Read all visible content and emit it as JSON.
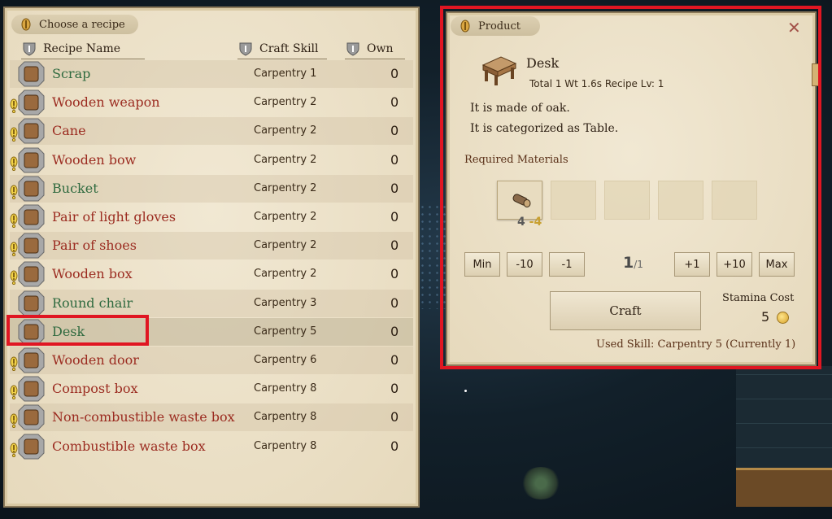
{
  "recipe_panel": {
    "tab_title": "Choose a recipe",
    "columns": {
      "name": "Recipe Name",
      "skill": "Craft Skill",
      "own": "Own"
    },
    "rows": [
      {
        "name": "Scrap",
        "skill": "Carpentry 1",
        "own": "0",
        "color": "green",
        "icon": "scrap-icon",
        "warn": false
      },
      {
        "name": "Wooden weapon",
        "skill": "Carpentry 2",
        "own": "0",
        "color": "red",
        "icon": "wooden-weapon-icon",
        "warn": true
      },
      {
        "name": "Cane",
        "skill": "Carpentry 2",
        "own": "0",
        "color": "red",
        "icon": "cane-icon",
        "warn": true
      },
      {
        "name": "Wooden bow",
        "skill": "Carpentry 2",
        "own": "0",
        "color": "red",
        "icon": "wooden-bow-icon",
        "warn": true
      },
      {
        "name": "Bucket",
        "skill": "Carpentry 2",
        "own": "0",
        "color": "green",
        "icon": "bucket-icon",
        "warn": true
      },
      {
        "name": "Pair of light gloves",
        "skill": "Carpentry 2",
        "own": "0",
        "color": "red",
        "icon": "gloves-icon",
        "warn": true
      },
      {
        "name": "Pair of shoes",
        "skill": "Carpentry 2",
        "own": "0",
        "color": "red",
        "icon": "shoes-icon",
        "warn": true
      },
      {
        "name": "Wooden box",
        "skill": "Carpentry 2",
        "own": "0",
        "color": "red",
        "icon": "wooden-box-icon",
        "warn": true
      },
      {
        "name": "Round chair",
        "skill": "Carpentry 3",
        "own": "0",
        "color": "green",
        "icon": "round-chair-icon",
        "warn": false
      },
      {
        "name": "Desk",
        "skill": "Carpentry 5",
        "own": "0",
        "color": "green",
        "icon": "desk-icon",
        "warn": false
      },
      {
        "name": "Wooden door",
        "skill": "Carpentry 6",
        "own": "0",
        "color": "red",
        "icon": "wooden-door-icon",
        "warn": true
      },
      {
        "name": "Compost box",
        "skill": "Carpentry 8",
        "own": "0",
        "color": "red",
        "icon": "compost-box-icon",
        "warn": true
      },
      {
        "name": "Non-combustible waste box",
        "skill": "Carpentry 8",
        "own": "0",
        "color": "red",
        "icon": "noncombustible-box-icon",
        "warn": true
      },
      {
        "name": "Combustible waste box",
        "skill": "Carpentry 8",
        "own": "0",
        "color": "red",
        "icon": "combustible-box-icon",
        "warn": true
      }
    ],
    "selected_row": "Desk"
  },
  "product_panel": {
    "tab_title": "Product",
    "close_label": "✕",
    "product_name": "Desk",
    "meta": "Total 1  Wt 1.6s  Recipe Lv: 1",
    "description": [
      "It is made of oak.",
      "It is categorized as Table."
    ],
    "required_materials_label": "Required Materials",
    "materials": [
      {
        "icon": "log-icon",
        "have": "4",
        "need": "4"
      }
    ],
    "quantity_buttons": {
      "min": "Min",
      "minus10": "-10",
      "minus1": "-1",
      "plus1": "+1",
      "plus10": "+10",
      "max": "Max"
    },
    "quantity": {
      "current": "1",
      "total": "/1"
    },
    "craft_label": "Craft",
    "stamina_label": "Stamina Cost",
    "stamina_value": "5",
    "used_skill": "Used Skill: Carpentry 5 (Currently 1)"
  },
  "colors": {
    "green_text": "#2f6a3f",
    "red_text": "#9b2b20",
    "highlight": "#e01622"
  }
}
